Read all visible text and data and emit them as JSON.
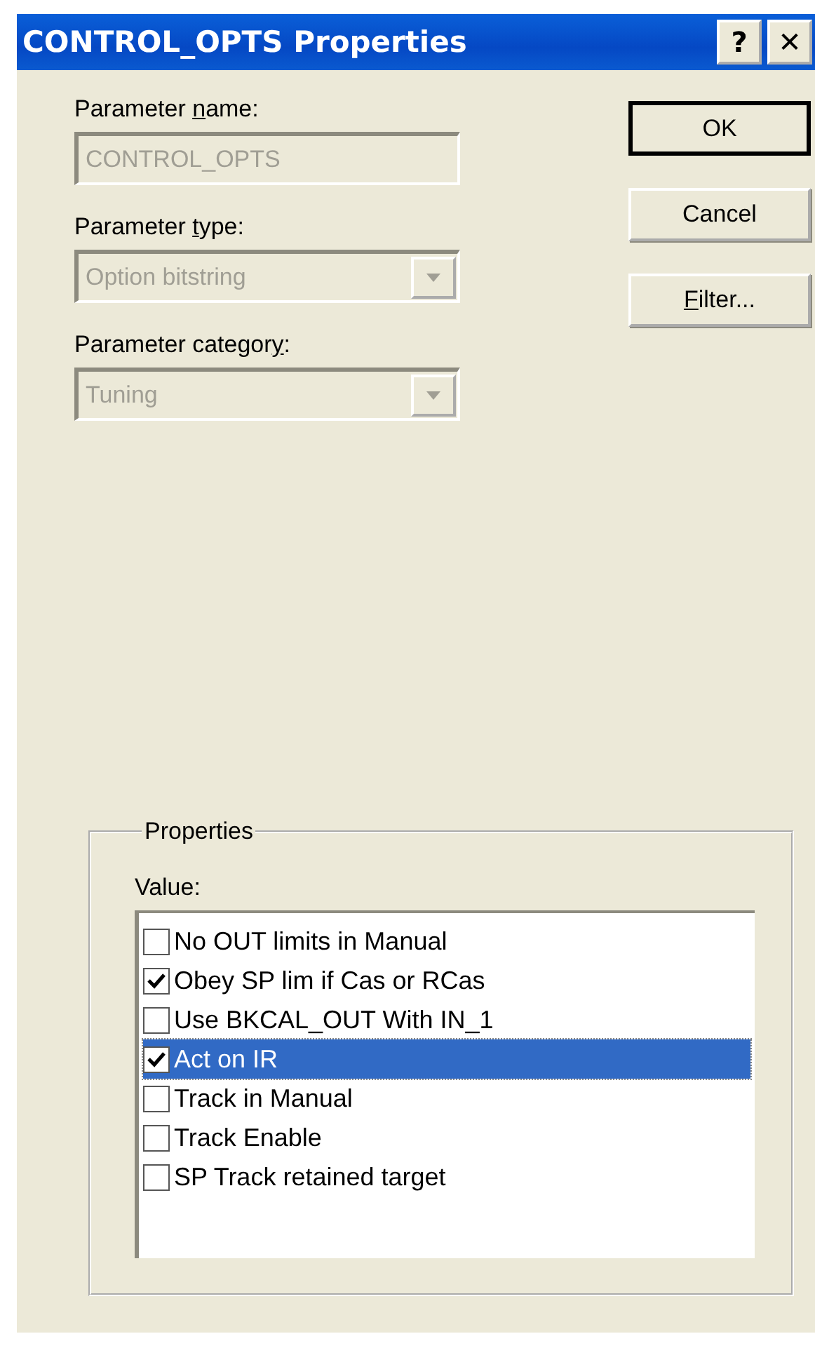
{
  "window": {
    "title": "CONTROL_OPTS Properties",
    "title_buttons": [
      "?",
      "✕"
    ]
  },
  "fields": [
    {
      "kind": "text",
      "label": {
        "before": "Parameter ",
        "access_key": "n",
        "after": "ame:"
      },
      "value": "CONTROL_OPTS",
      "disabled": true
    },
    {
      "kind": "combo",
      "label": {
        "before": "Parameter ",
        "access_key": "t",
        "after": "ype:"
      },
      "value": "Option bitstring",
      "disabled": true
    },
    {
      "kind": "combo",
      "label": {
        "before": "Parameter categor",
        "access_key": "y",
        "after": ":"
      },
      "value": "Tuning",
      "disabled": true
    }
  ],
  "buttons": [
    {
      "label": {
        "before": "OK"
      },
      "default": true
    },
    {
      "label": {
        "before": "Cancel"
      },
      "default": false
    },
    {
      "label": {
        "access_key": "F",
        "after": "ilter..."
      },
      "default": false
    }
  ],
  "properties": {
    "title": "Properties",
    "value_label": "Value:",
    "items": [
      {
        "label": "No OUT limits in Manual",
        "checked": false,
        "selected": false
      },
      {
        "label": "Obey SP lim if Cas or RCas",
        "checked": true,
        "selected": false
      },
      {
        "label": "Use BKCAL_OUT With IN_1",
        "checked": false,
        "selected": false
      },
      {
        "label": "Act on IR",
        "checked": true,
        "selected": true
      },
      {
        "label": "Track in Manual",
        "checked": false,
        "selected": false
      },
      {
        "label": "Track Enable",
        "checked": false,
        "selected": false
      },
      {
        "label": "SP Track retained target",
        "checked": false,
        "selected": false
      }
    ]
  }
}
